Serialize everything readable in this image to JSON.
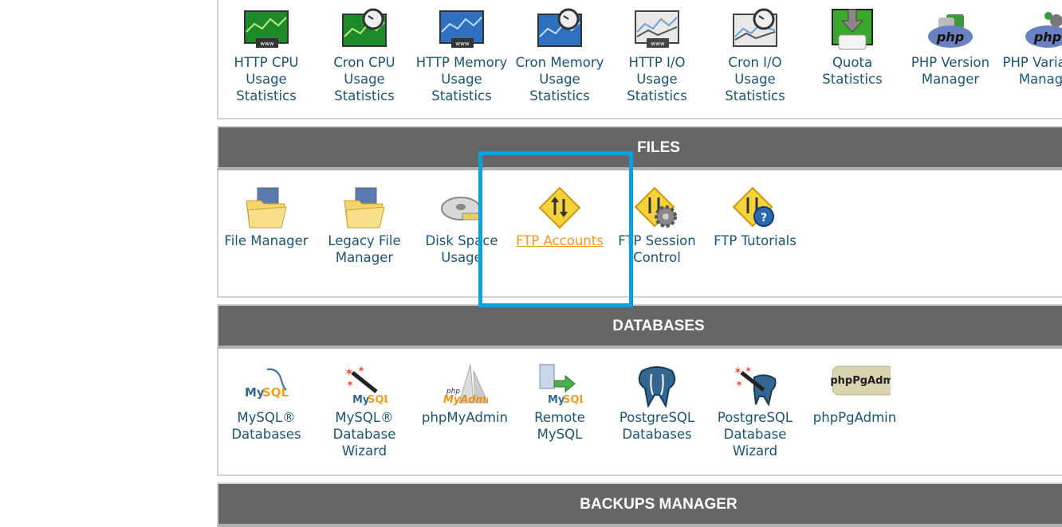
{
  "metrics": {
    "items": [
      {
        "label": "HTTP CPU Usage Statistics",
        "icon": "http-cpu-chart-icon"
      },
      {
        "label": "Cron CPU Usage Statistics",
        "icon": "cron-cpu-chart-icon"
      },
      {
        "label": "HTTP Memory Usage Statistics",
        "icon": "http-memory-chart-icon"
      },
      {
        "label": "Cron Memory Usage Statistics",
        "icon": "cron-memory-chart-icon"
      },
      {
        "label": "HTTP I/O Usage Statistics",
        "icon": "http-io-chart-icon"
      },
      {
        "label": "Cron I/O Usage Statistics",
        "icon": "cron-io-chart-icon"
      },
      {
        "label": "Quota Statistics",
        "icon": "quota-drive-icon"
      },
      {
        "label": "PHP Version Manager",
        "icon": "php-version-icon"
      },
      {
        "label": "PHP Variables Manager",
        "icon": "php-variables-icon"
      }
    ]
  },
  "files": {
    "title": "FILES",
    "items": [
      {
        "label": "File Manager",
        "icon": "folder-icon"
      },
      {
        "label": "Legacy File Manager",
        "icon": "folder-icon"
      },
      {
        "label": "Disk Space Usage",
        "icon": "disk-icon"
      },
      {
        "label": "FTP Accounts",
        "icon": "ftp-icon",
        "active": true
      },
      {
        "label": "FTP Session Control",
        "icon": "ftp-gear-icon"
      },
      {
        "label": "FTP Tutorials",
        "icon": "ftp-help-icon"
      }
    ]
  },
  "databases": {
    "title": "DATABASES",
    "items": [
      {
        "label": "MySQL® Databases",
        "icon": "mysql-icon"
      },
      {
        "label": "MySQL® Database Wizard",
        "icon": "mysql-wizard-icon"
      },
      {
        "label": "phpMyAdmin",
        "icon": "phpmyadmin-icon"
      },
      {
        "label": "Remote MySQL",
        "icon": "remote-mysql-icon"
      },
      {
        "label": "PostgreSQL Databases",
        "icon": "postgresql-icon"
      },
      {
        "label": "PostgreSQL Database Wizard",
        "icon": "postgresql-wizard-icon"
      },
      {
        "label": "phpPgAdmin",
        "icon": "phppgadmin-icon"
      }
    ]
  },
  "backups": {
    "title": "BACKUPS MANAGER"
  },
  "colors": {
    "header_bg": "#666666",
    "link": "#1a5470",
    "active_link": "#f0961e",
    "highlight": "#0aa0e6"
  }
}
